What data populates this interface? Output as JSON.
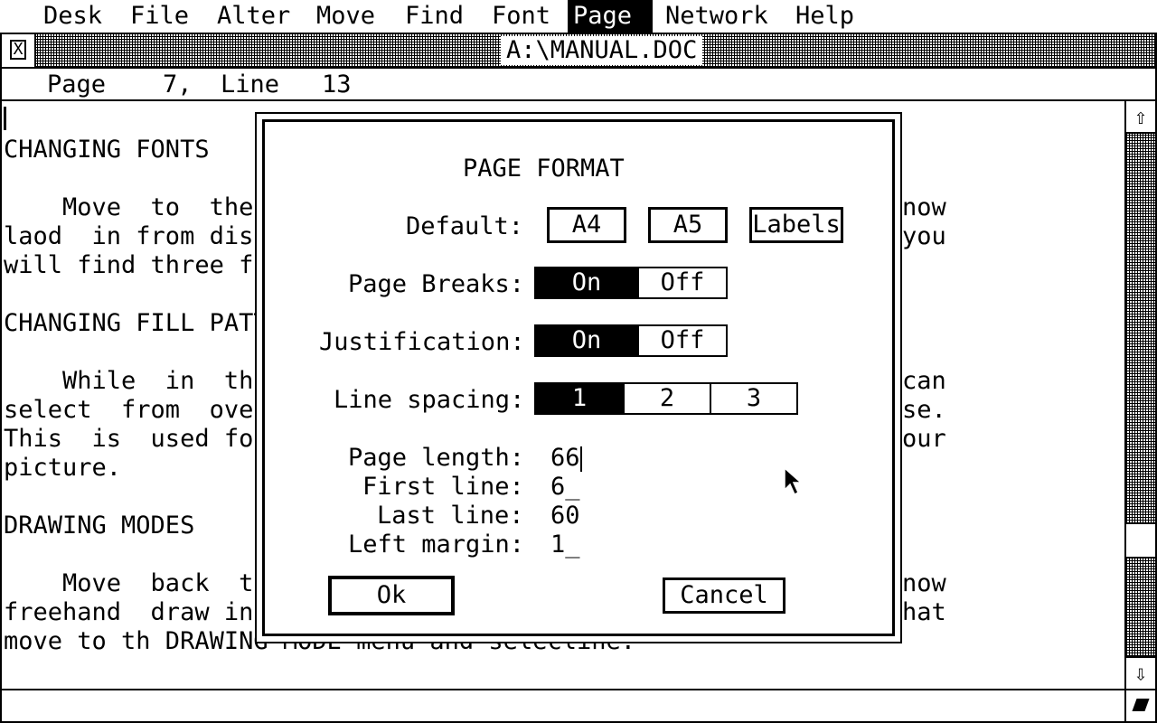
{
  "menubar": {
    "items": [
      {
        "label": "Desk",
        "active": false
      },
      {
        "label": "File",
        "active": false
      },
      {
        "label": "Alter",
        "active": false
      },
      {
        "label": "Move",
        "active": false
      },
      {
        "label": "Find",
        "active": false
      },
      {
        "label": "Font",
        "active": false
      },
      {
        "label": "Page",
        "active": true
      },
      {
        "label": "Network",
        "active": false
      },
      {
        "label": "Help",
        "active": false
      }
    ]
  },
  "window": {
    "title": "A:\\MANUAL.DOC",
    "close_glyph": "X",
    "info": {
      "page_label": "Page",
      "page_value": "7,",
      "line_label": "Line",
      "line_value": "13"
    }
  },
  "document": {
    "lines": [
      "CHANGING FONTS",
      "",
      "    Move  to  the",
      "laod  in from disk",
      "will find three fo",
      "",
      "CHANGING FILL PATT",
      "",
      "    While  in  the",
      "select  from  over",
      "This  is  used for",
      "picture.",
      "",
      "DRAWING MODES",
      "",
      "    Move  back  to",
      "freehand  draw in",
      "move to th DRAWING MODE menu and selecline."
    ],
    "right_fragments": [
      "now",
      "you",
      "can",
      "se.",
      "our",
      "now",
      "hat"
    ]
  },
  "dialog": {
    "title": "PAGE FORMAT",
    "default_label": "Default:",
    "default_buttons": [
      "A4",
      "A5",
      "Labels"
    ],
    "page_breaks_label": "Page Breaks:",
    "page_breaks_options": [
      "On",
      "Off"
    ],
    "page_breaks_selected": "On",
    "justification_label": "Justification:",
    "justification_options": [
      "On",
      "Off"
    ],
    "justification_selected": "On",
    "line_spacing_label": "Line spacing:",
    "line_spacing_options": [
      "1",
      "2",
      "3"
    ],
    "line_spacing_selected": "1",
    "page_length_label": "Page length:",
    "page_length_value": "66",
    "first_line_label": "First line:",
    "first_line_value": "6_",
    "last_line_label": "Last line:",
    "last_line_value": "60",
    "left_margin_label": "Left margin:",
    "left_margin_value": "1_",
    "ok_label": "Ok",
    "cancel_label": "Cancel"
  },
  "scrollbar": {
    "up_glyph": "⇧",
    "down_glyph": "⇩"
  }
}
